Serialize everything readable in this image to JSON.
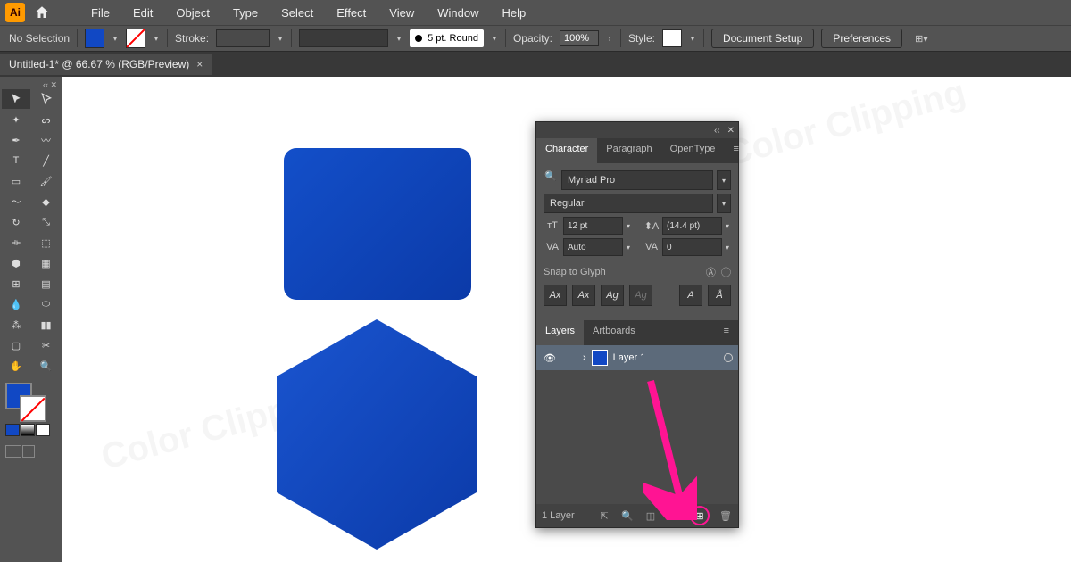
{
  "menubar": {
    "items": [
      "File",
      "Edit",
      "Object",
      "Type",
      "Select",
      "Effect",
      "View",
      "Window",
      "Help"
    ]
  },
  "optionsbar": {
    "selection_status": "No Selection",
    "stroke_label": "Stroke:",
    "brush_label": "5 pt. Round",
    "opacity_label": "Opacity:",
    "opacity_value": "100%",
    "style_label": "Style:",
    "doc_setup": "Document Setup",
    "preferences": "Preferences"
  },
  "tab": {
    "title": "Untitled-1* @ 66.67 % (RGB/Preview)"
  },
  "character_panel": {
    "tabs": [
      "Character",
      "Paragraph",
      "OpenType"
    ],
    "font_family": "Myriad Pro",
    "font_style": "Regular",
    "font_size": "12 pt",
    "leading": "(14.4 pt)",
    "kerning": "Auto",
    "tracking": "0",
    "snap_label": "Snap to Glyph"
  },
  "layers_panel": {
    "tabs": [
      "Layers",
      "Artboards"
    ],
    "layer_name": "Layer 1",
    "footer_count": "1 Layer"
  },
  "colors": {
    "fill": "#1148c4",
    "highlight": "#ff1493"
  }
}
